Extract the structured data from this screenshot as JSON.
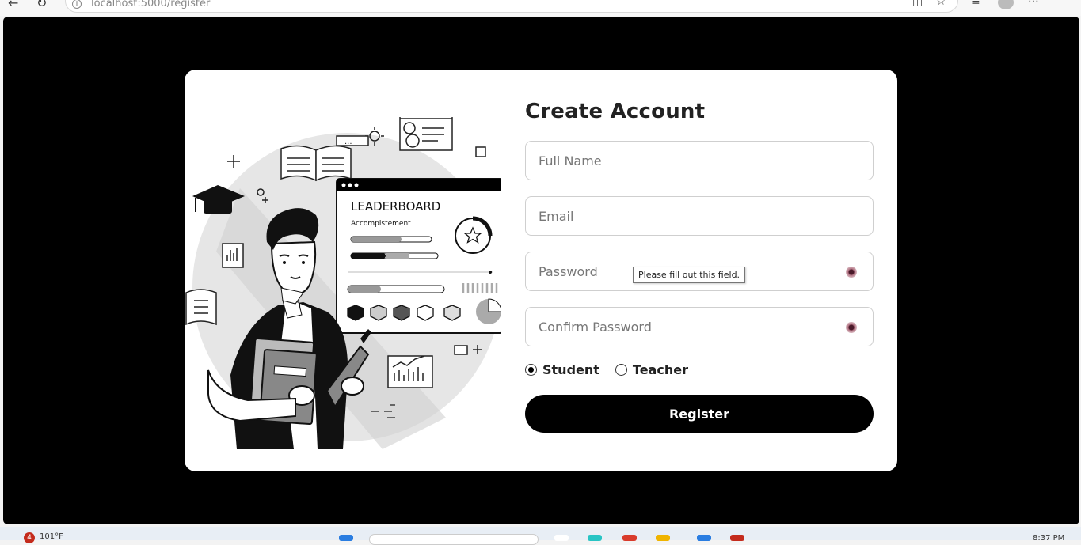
{
  "browser": {
    "url_host": "localhost",
    "url_rest": ":5000/register"
  },
  "form": {
    "title": "Create Account",
    "full_name_placeholder": "Full Name",
    "email_placeholder": "Email",
    "password_placeholder": "Password",
    "confirm_password_placeholder": "Confirm Password",
    "role_student": "Student",
    "role_teacher": "Teacher",
    "selected_role": "Student",
    "register_label": "Register"
  },
  "tooltip": "Please fill out this field.",
  "illustration": {
    "board_title": "LEADERBOARD",
    "board_subtitle": "Accompistement"
  },
  "taskbar": {
    "weather_badge": "4",
    "weather_temp": "101°F",
    "clock": "8:37 PM"
  },
  "colors": {
    "page_bg": "#000000",
    "card_bg": "#ffffff",
    "button_bg": "#000000",
    "button_text": "#ffffff"
  }
}
